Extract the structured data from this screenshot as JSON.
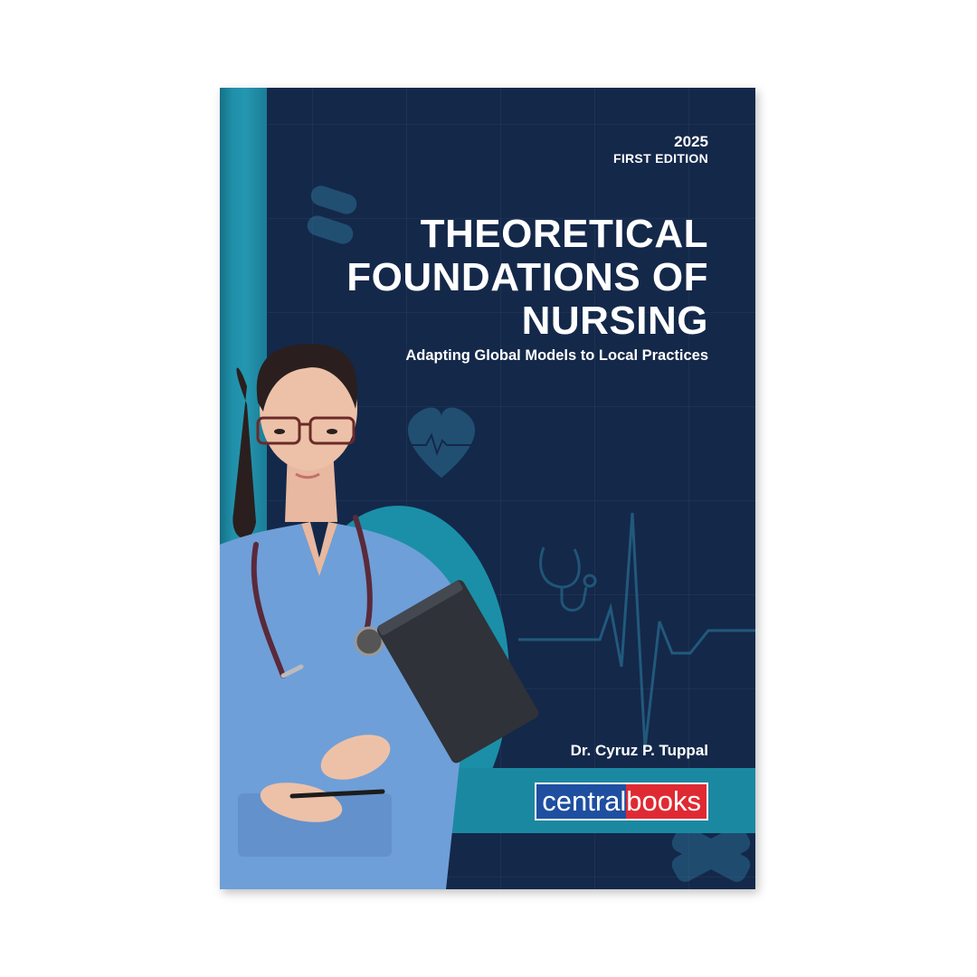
{
  "cover": {
    "year": "2025",
    "edition": "FIRST EDITION",
    "title_lines": [
      "THEORETICAL",
      "FOUNDATIONS OF",
      "NURSING"
    ],
    "subtitle": "Adapting Global Models to Local Practices",
    "author": "Dr. Cyruz P. Tuppal",
    "publisher_part1": "central",
    "publisher_part2": "books"
  },
  "colors": {
    "background": "#14284a",
    "spine": "#2596b0",
    "accent_teal": "#1b8fa8",
    "scrubs": "#6f9fd8",
    "logo_blue": "#1f4fa0",
    "logo_red": "#e02a33"
  },
  "icons": [
    "pill-icon",
    "heart-pulse-icon",
    "stethoscope-icon",
    "ecg-line-icon",
    "bandage-icon"
  ]
}
